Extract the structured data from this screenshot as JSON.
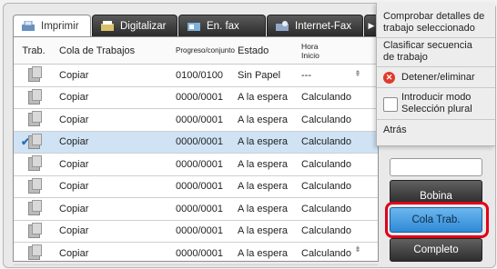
{
  "tabs": [
    {
      "label": "Imprimir",
      "icon": "printer-icon"
    },
    {
      "label": "Digitalizar",
      "icon": "scanner-icon"
    },
    {
      "label": "En. fax",
      "icon": "fax-icon"
    },
    {
      "label": "Internet-Fax",
      "icon": "internet-fax-icon"
    }
  ],
  "tab_more": "▶",
  "table": {
    "headers": {
      "job": "Trab.",
      "queue": "Cola de Trabajos",
      "progress": "Progreso/conjunto",
      "state": "Estado",
      "start_line1": "Hora",
      "start_line2": "Inicio"
    },
    "rows": [
      {
        "name": "Copiar",
        "progress": "0100/0100",
        "state": "Sin Papel",
        "start": "---",
        "selected": false
      },
      {
        "name": "Copiar",
        "progress": "0000/0001",
        "state": "A la espera",
        "start": "Calculando",
        "selected": false
      },
      {
        "name": "Copiar",
        "progress": "0000/0001",
        "state": "A la espera",
        "start": "Calculando",
        "selected": false
      },
      {
        "name": "Copiar",
        "progress": "0000/0001",
        "state": "A la espera",
        "start": "Calculando",
        "selected": true
      },
      {
        "name": "Copiar",
        "progress": "0000/0001",
        "state": "A la espera",
        "start": "Calculando",
        "selected": false
      },
      {
        "name": "Copiar",
        "progress": "0000/0001",
        "state": "A la espera",
        "start": "Calculando",
        "selected": false
      },
      {
        "name": "Copiar",
        "progress": "0000/0001",
        "state": "A la espera",
        "start": "Calculando",
        "selected": false
      },
      {
        "name": "Copiar",
        "progress": "0000/0001",
        "state": "A la espera",
        "start": "Calculando",
        "selected": false
      },
      {
        "name": "Copiar",
        "progress": "0000/0001",
        "state": "A la espera",
        "start": "Calculando",
        "selected": false
      }
    ],
    "scroll_up": "⇞",
    "scroll_down": "⇟"
  },
  "menu": {
    "item1_line1": "Comprobar detalles de",
    "item1_line2": "trabajo seleccionado",
    "item2_line1": "Clasificar secuencia",
    "item2_line2": "de trabajo",
    "item3": "Detener/eliminar",
    "item4_line1": "Introducir modo",
    "item4_line2": "Selección plural",
    "item5": "Atrás"
  },
  "panel": {
    "spool": "Bobina",
    "job_queue": "Cola Trab.",
    "complete": "Completo"
  },
  "colors": {
    "selected_row": "#cfe3f5",
    "highlight": "#e0001a",
    "active_button": "#3d94db"
  }
}
